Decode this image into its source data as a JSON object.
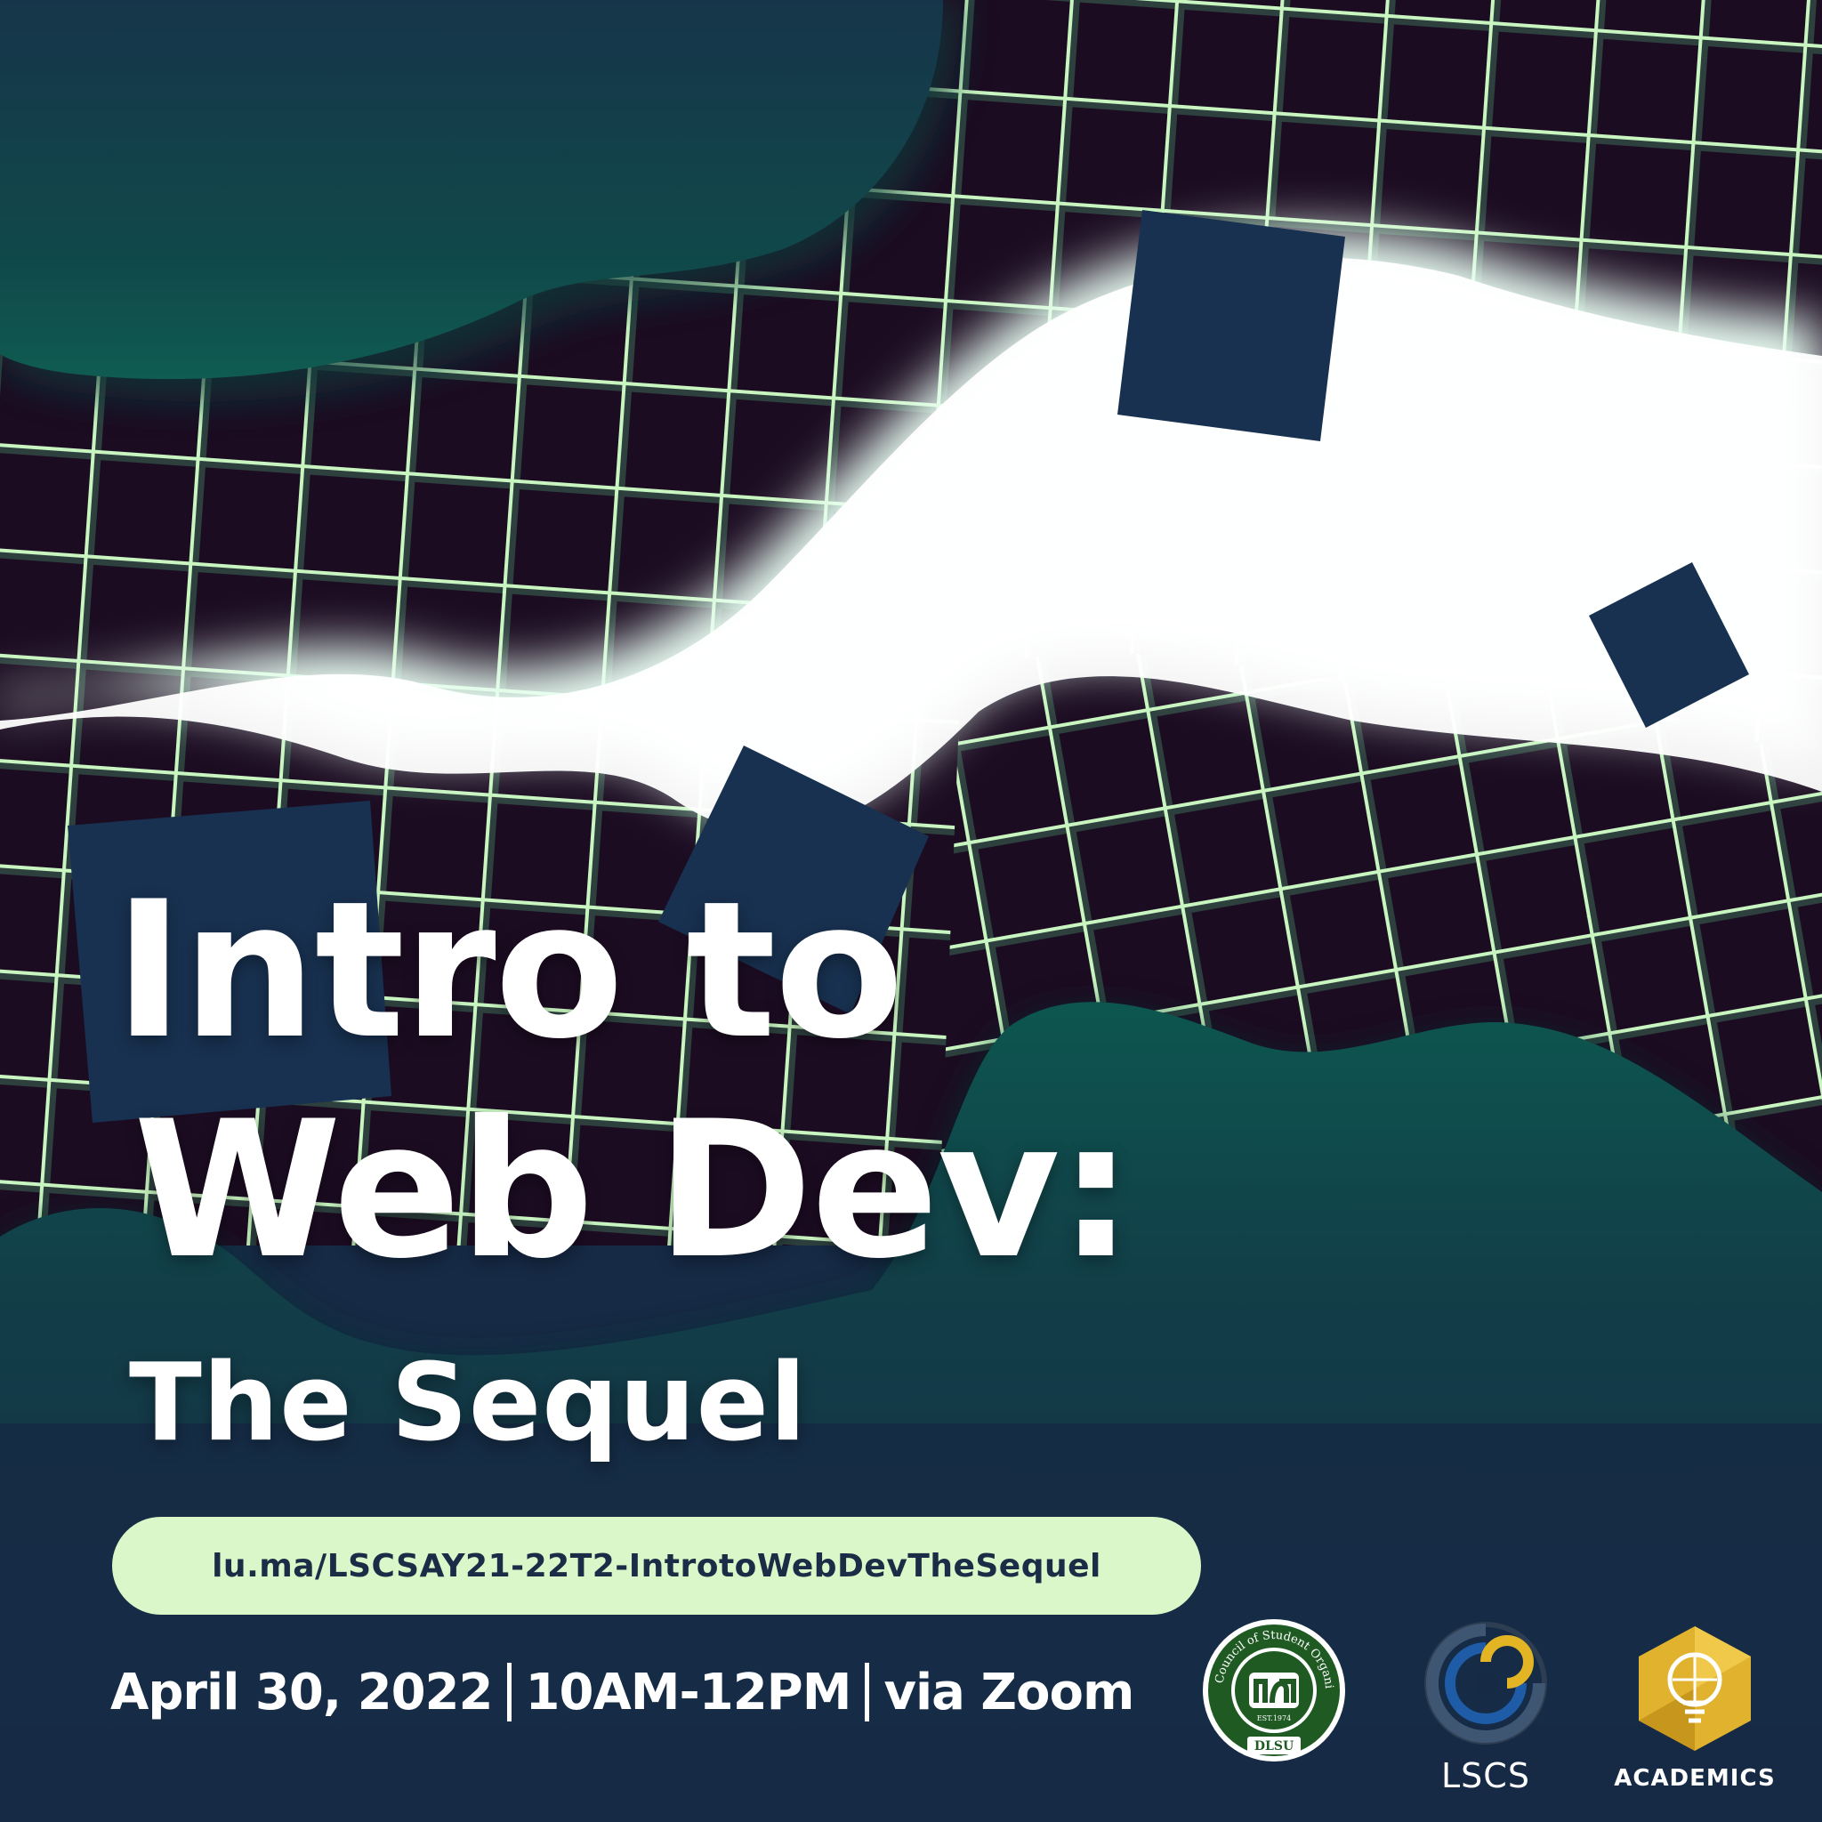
{
  "title": {
    "line1": "Intro to",
    "line2": "Web Dev:",
    "line3": "The Sequel"
  },
  "registration_link": "lu.ma/LSCSAY21-22T2-IntrotoWebDevTheSequel",
  "event": {
    "date": "April 30, 2022",
    "time": "10AM-12PM",
    "venue": "via Zoom"
  },
  "logos": {
    "cso": {
      "ring_text": "Council of Student Organizations",
      "est": "EST.1974",
      "school": "DLSU",
      "icon": "cso-seal-icon"
    },
    "lscs": {
      "label": "LSCS",
      "icon": "lscs-logo-icon"
    },
    "academics": {
      "label": "ACADEMICS",
      "icon": "lightbulb-puzzle-icon"
    }
  },
  "colors": {
    "navy": "#162a45",
    "teal": "#0f4f4a",
    "grid_line": "#c8f5c0",
    "glow": "#ffffff",
    "pill": "#d9f7c8",
    "gold": "#e0b22e",
    "cso_green": "#1f5a23"
  }
}
